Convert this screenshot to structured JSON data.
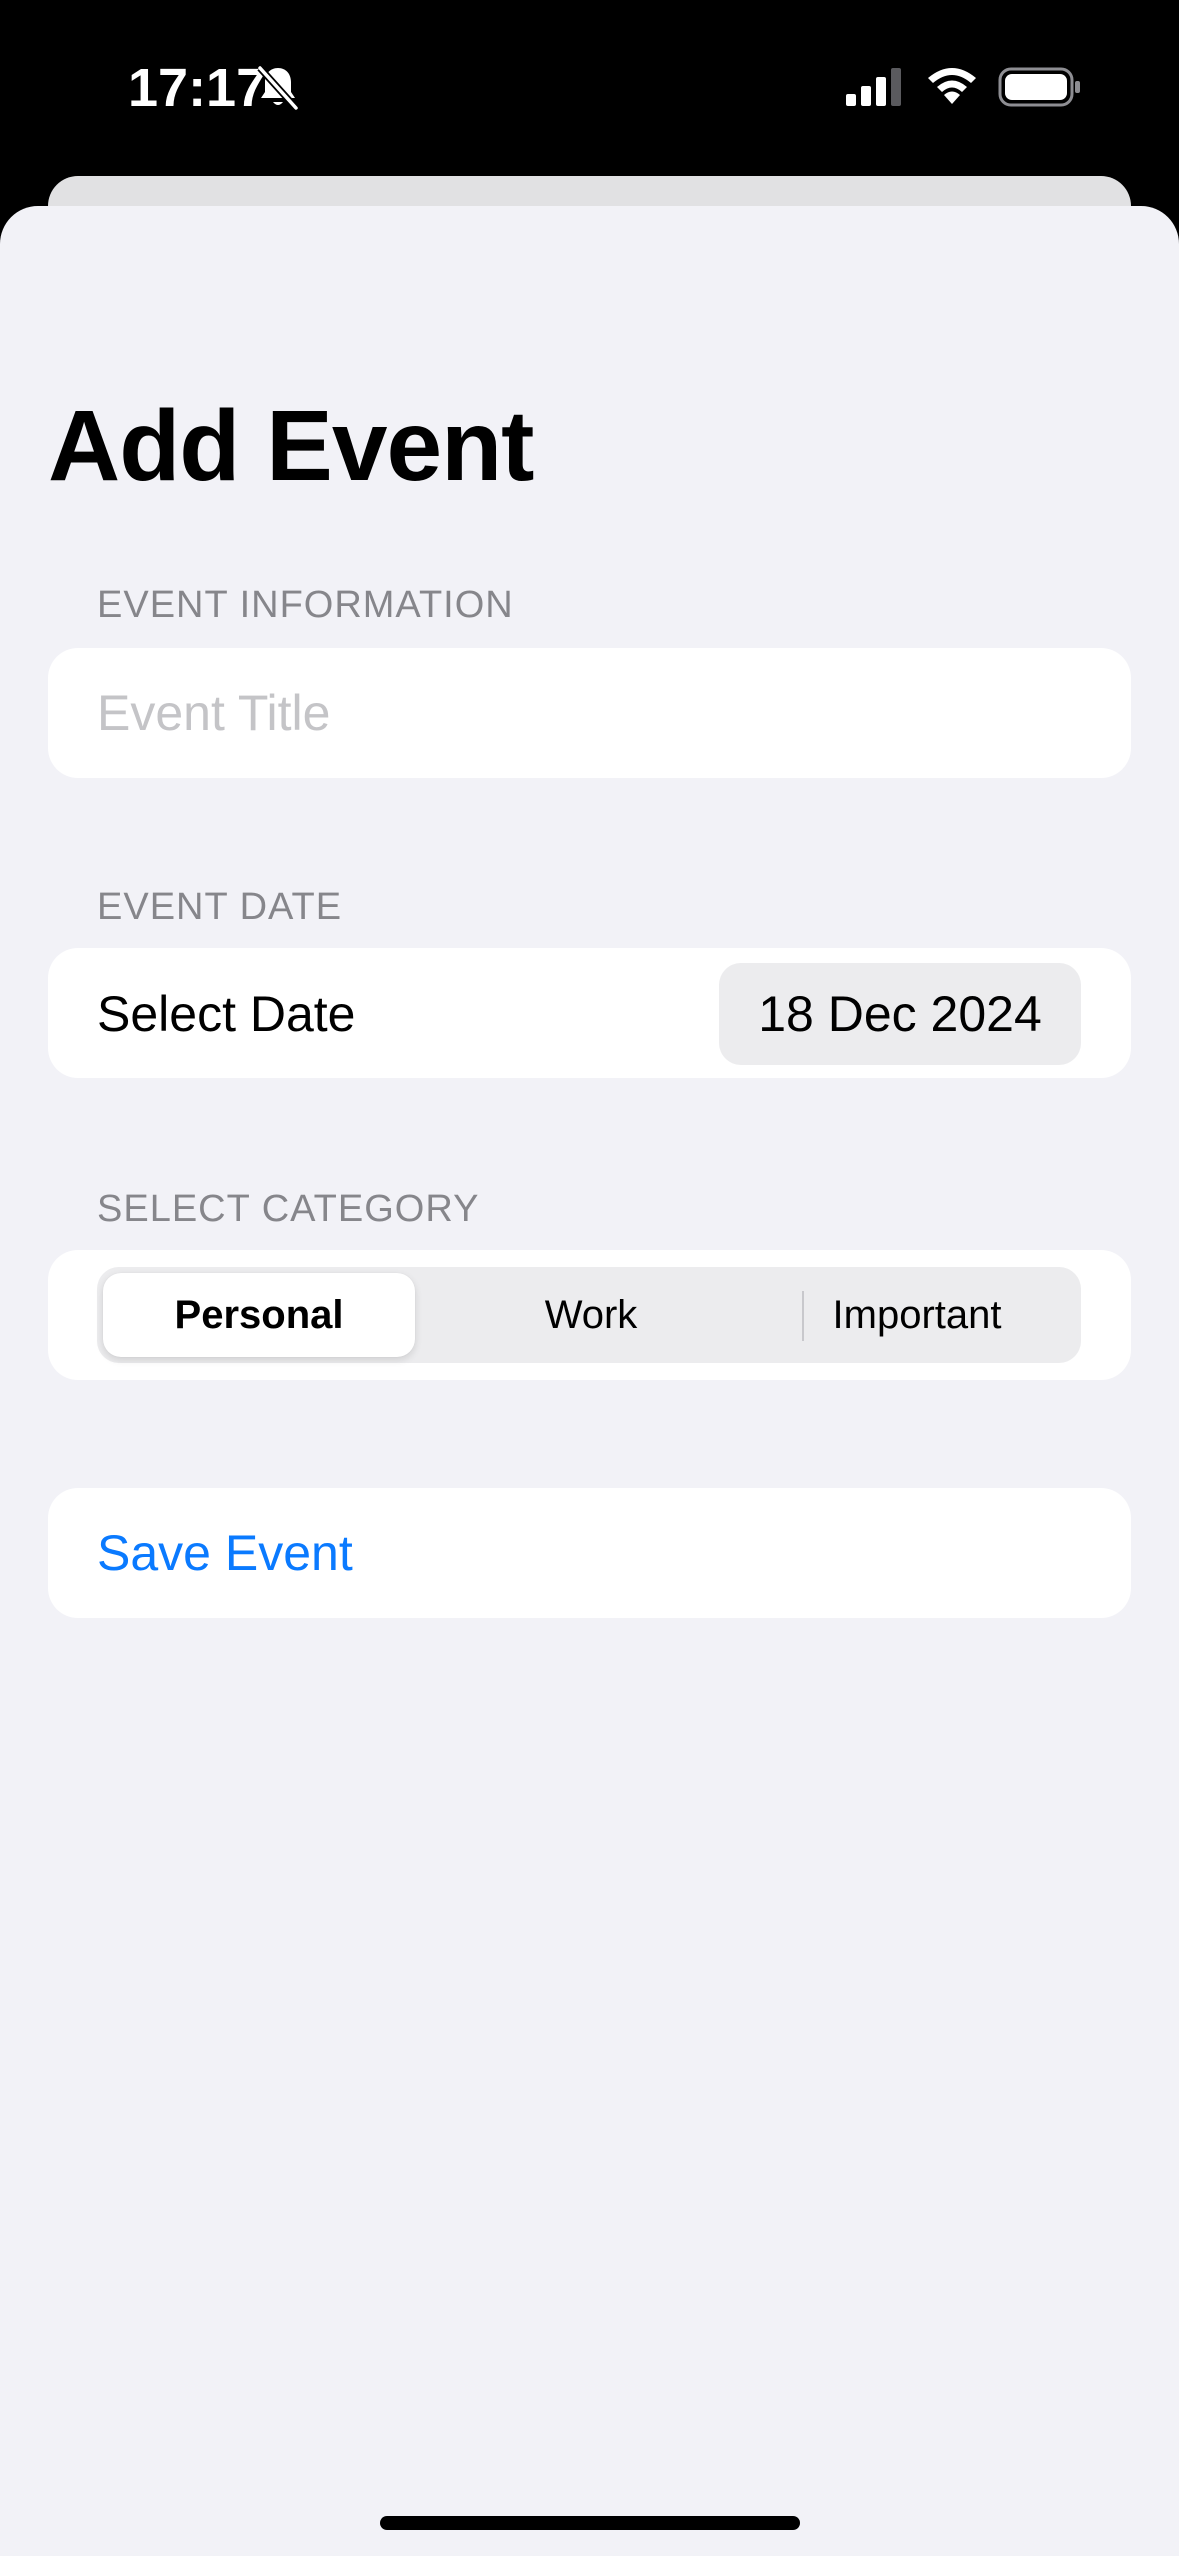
{
  "status_bar": {
    "time": "17:17",
    "icons": [
      "bell-slash-icon",
      "cellular-signal-icon",
      "wifi-icon",
      "battery-icon"
    ]
  },
  "page": {
    "title": "Add Event"
  },
  "event_information": {
    "header": "EVENT INFORMATION",
    "title_field": {
      "placeholder": "Event Title",
      "value": ""
    }
  },
  "event_date": {
    "header": "EVENT DATE",
    "label": "Select Date",
    "value": "18 Dec 2024"
  },
  "category": {
    "header": "SELECT CATEGORY",
    "options": [
      "Personal",
      "Work",
      "Important"
    ],
    "selected": "Personal"
  },
  "actions": {
    "save_label": "Save Event"
  },
  "colors": {
    "accent": "#0a7aff",
    "background": "#f2f2f7",
    "card": "#ffffff",
    "section_header": "#86868b",
    "placeholder": "#c4c4c7"
  }
}
